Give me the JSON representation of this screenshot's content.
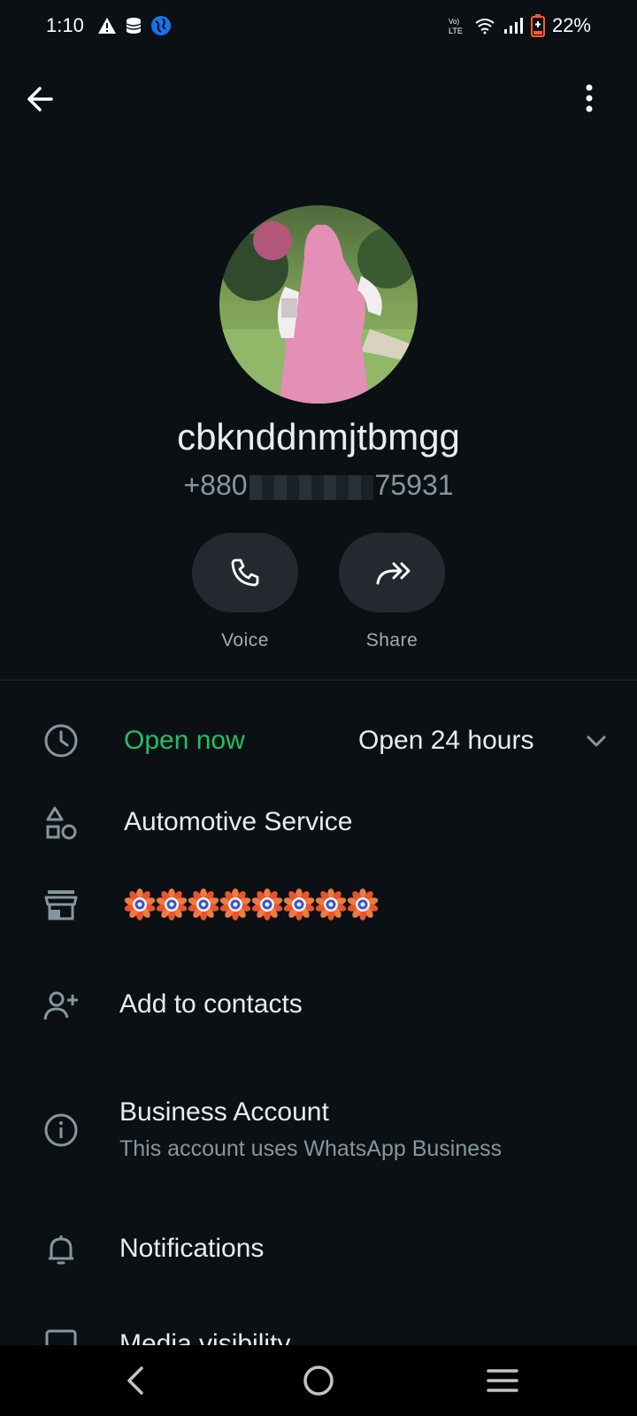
{
  "status_bar": {
    "time": "1:10",
    "battery": "22%",
    "icons": [
      "warning-icon",
      "database-icon",
      "globe-icon",
      "volte-icon",
      "wifi-icon",
      "signal-icon",
      "battery-icon"
    ]
  },
  "contact": {
    "name": "cbknddnmjtbmgg",
    "phone_prefix": "+880",
    "phone_suffix": "75931"
  },
  "actions": [
    {
      "label": "Voice",
      "icon": "phone-icon"
    },
    {
      "label": "Share",
      "icon": "share-icon"
    }
  ],
  "business_hours": {
    "status": "Open now",
    "hours": "Open 24 hours",
    "status_color": "#21c063"
  },
  "category": "Automotive Service",
  "description_icon": "flower-emoji",
  "description_count": 8,
  "add_contact": "Add to contacts",
  "business_account": {
    "title": "Business Account",
    "subtitle": "This account uses WhatsApp Business"
  },
  "notifications": "Notifications",
  "media_visibility": "Media visibility"
}
